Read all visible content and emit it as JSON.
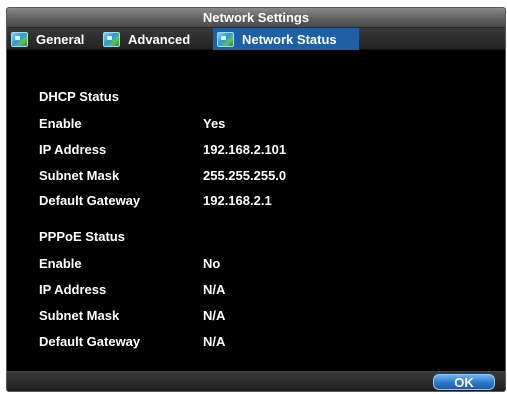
{
  "window": {
    "title": "Network Settings"
  },
  "tabs": [
    {
      "label": "General",
      "icon": "network-settings-icon",
      "active": false
    },
    {
      "label": "Advanced",
      "icon": "network-settings-icon",
      "active": false
    },
    {
      "label": "Network Status",
      "icon": "network-settings-icon",
      "active": true
    }
  ],
  "dhcp": {
    "heading": "DHCP Status",
    "rows": [
      {
        "label": "Enable",
        "value": "Yes"
      },
      {
        "label": "IP Address",
        "value": "192.168.2.101"
      },
      {
        "label": "Subnet Mask",
        "value": "255.255.255.0"
      },
      {
        "label": "Default Gateway",
        "value": "192.168.2.1"
      }
    ]
  },
  "pppoe": {
    "heading": "PPPoE Status",
    "rows": [
      {
        "label": "Enable",
        "value": "No"
      },
      {
        "label": "IP Address",
        "value": "N/A"
      },
      {
        "label": "Subnet Mask",
        "value": "N/A"
      },
      {
        "label": "Default Gateway",
        "value": "N/A"
      }
    ]
  },
  "footer": {
    "ok_label": "OK"
  },
  "colors": {
    "background": "#000000",
    "active_tab": "#1f5fa6",
    "text": "#ffffff",
    "ok_button": "#2a78c8"
  }
}
